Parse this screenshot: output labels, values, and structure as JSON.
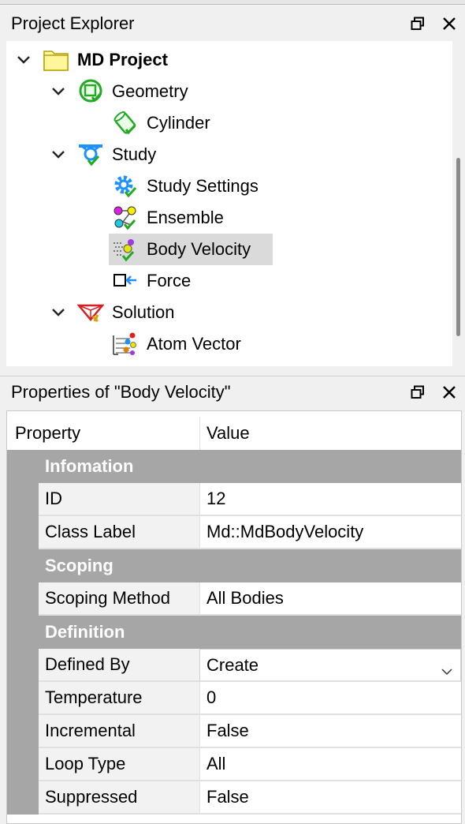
{
  "explorer": {
    "title": "Project Explorer",
    "tree": [
      {
        "label": "MD Project",
        "level": 0,
        "expanded": true,
        "bold": true,
        "icon": "folder-icon"
      },
      {
        "label": "Geometry",
        "level": 1,
        "expanded": true,
        "icon": "geometry-icon"
      },
      {
        "label": "Cylinder",
        "level": 2,
        "icon": "cylinder-icon"
      },
      {
        "label": "Study",
        "level": 1,
        "expanded": true,
        "icon": "study-icon"
      },
      {
        "label": "Study Settings",
        "level": 2,
        "icon": "study-settings-icon"
      },
      {
        "label": "Ensemble",
        "level": 2,
        "icon": "ensemble-icon"
      },
      {
        "label": "Body Velocity",
        "level": 2,
        "icon": "body-velocity-icon",
        "selected": true
      },
      {
        "label": "Force",
        "level": 2,
        "icon": "force-icon"
      },
      {
        "label": "Solution",
        "level": 1,
        "expanded": true,
        "icon": "solution-icon"
      },
      {
        "label": "Atom Vector",
        "level": 2,
        "icon": "atom-vector-icon"
      }
    ]
  },
  "properties": {
    "title": "Properties of \"Body Velocity\"",
    "header": {
      "property": "Property",
      "value": "Value"
    },
    "categories": [
      {
        "name": "Infomation",
        "items": [
          {
            "property": "ID",
            "value": "12"
          },
          {
            "property": "Class Label",
            "value": "Md::MdBodyVelocity"
          }
        ]
      },
      {
        "name": "Scoping",
        "items": [
          {
            "property": "Scoping Method",
            "value": "All Bodies"
          }
        ]
      },
      {
        "name": "Definition",
        "items": [
          {
            "property": "Defined By",
            "value": "Create",
            "dropdown": true
          },
          {
            "property": "Temperature",
            "value": "0"
          },
          {
            "property": "Incremental",
            "value": "False"
          },
          {
            "property": "Loop Type",
            "value": "All"
          },
          {
            "property": "Suppressed",
            "value": "False"
          }
        ]
      }
    ]
  }
}
